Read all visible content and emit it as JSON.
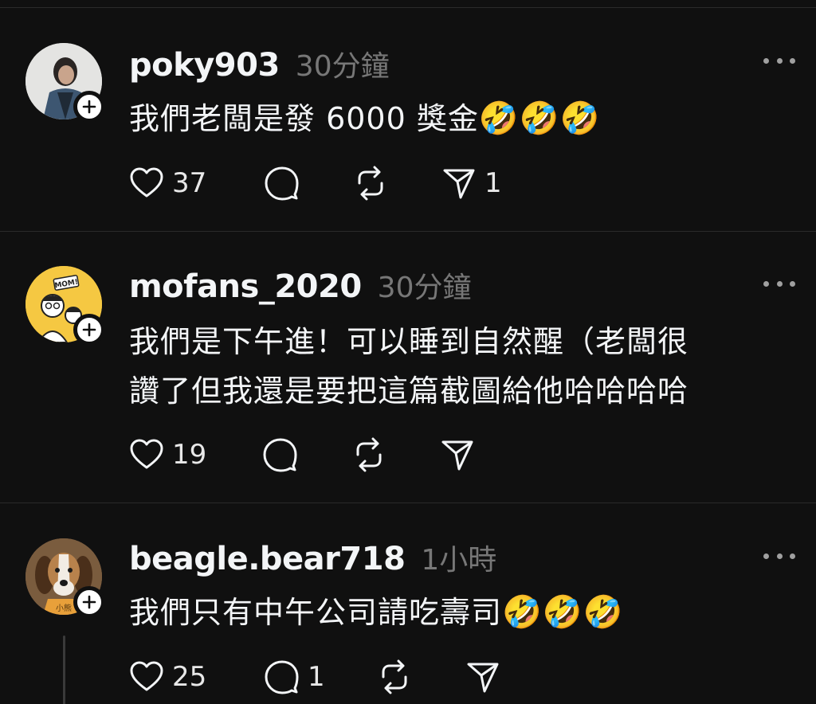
{
  "posts": [
    {
      "username": "poky903",
      "time": "30分鐘",
      "text": "我們老闆是發 6000 獎金",
      "emoji": "🤣🤣🤣",
      "likes": "37",
      "replies": "",
      "reposts": "",
      "shares": "1",
      "avatar_icon": "person-photo"
    },
    {
      "username": "mofans_2020",
      "time": "30分鐘",
      "text_line1": "我們是下午進！可以睡到自然醒（老闆很",
      "text_line2": "讚了但我還是要把這篇截圖給他哈哈哈哈",
      "likes": "19",
      "replies": "",
      "reposts": "",
      "shares": "",
      "avatar_label": "MOM!",
      "avatar_icon": "cartoon-family"
    },
    {
      "username": "beagle.bear718",
      "time": "1小時",
      "text": "我們只有中午公司請吃壽司",
      "emoji": "🤣🤣🤣",
      "likes": "25",
      "replies": "1",
      "reposts": "",
      "shares": "",
      "avatar_label": "小熊",
      "avatar_icon": "beagle-dog"
    }
  ],
  "colors": {
    "background": "#101010",
    "text": "#f3f5f7",
    "muted": "#777777",
    "divider": "#2a2a2a"
  }
}
